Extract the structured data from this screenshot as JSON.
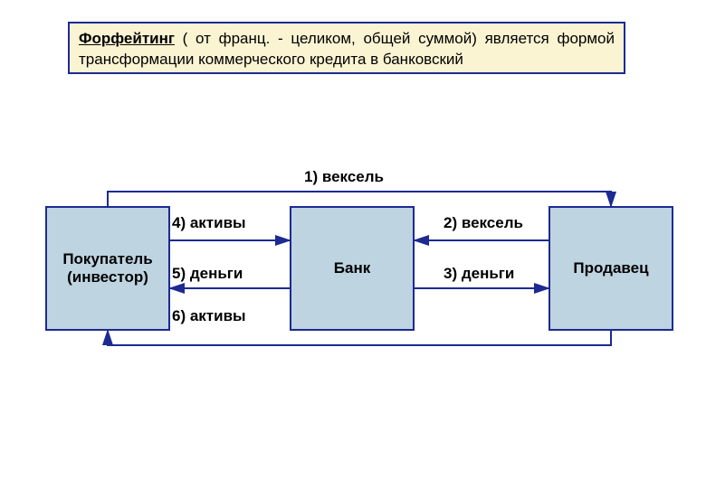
{
  "definition": {
    "term": "Форфейтинг",
    "rest": " ( от франц. - целиком, общей суммой) является формой трансформации коммерческого кредита в банковский"
  },
  "nodes": {
    "buyer": "Покупатель (инвестор)",
    "bank": "Банк",
    "seller": "Продавец"
  },
  "labels": {
    "l1": "1) вексель",
    "l2": "2) вексель",
    "l3": "3) деньги",
    "l4": "4) активы",
    "l5": "5) деньги",
    "l6": "6) активы"
  },
  "colors": {
    "border": "#1c2a92",
    "defbg": "#fbf4d3",
    "nodebg": "#bed4e1"
  }
}
